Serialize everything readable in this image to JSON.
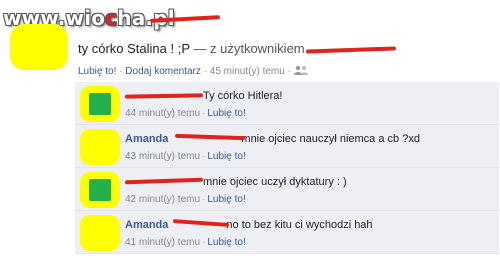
{
  "watermark": {
    "prefix": "www.wio",
    "dot_char": "c",
    "suffix": "ha.pl"
  },
  "post": {
    "text": "ty córko Stalina ! ;P",
    "via": " — z użytkownikiem",
    "meta": {
      "like": "Lubię to!",
      "sep": "·",
      "comment": "Dodaj komentarz",
      "time": "45 minut(y) temu",
      "icon": "friends-icon"
    }
  },
  "comments": [
    {
      "author": "",
      "text": "Ty córko Hitlera!",
      "time": "44 minut(y) temu",
      "like": "Lubię to!",
      "has_avatar_inner": true
    },
    {
      "author": "Amanda",
      "text": "mnie ojciec nauczył niemca a cb ?xd",
      "time": "43 minut(y) temu",
      "like": "Lubię to!",
      "has_avatar_inner": false
    },
    {
      "author": "",
      "text": "mnie ojciec uczył dyktatury : )",
      "time": "42 minut(y) temu",
      "like": "Lubię to!",
      "has_avatar_inner": true
    },
    {
      "author": "Amanda",
      "text": "no to bez kitu ci wychodzi hah",
      "time": "41 minut(y) temu",
      "like": "Lubię to!",
      "has_avatar_inner": false
    }
  ],
  "colors": {
    "link": "#3b5998",
    "comment_bg": "#edeff4",
    "avatar_yellow": "#ffff00",
    "avatar_green": "#22b14c",
    "redaction": "#e0231b"
  }
}
